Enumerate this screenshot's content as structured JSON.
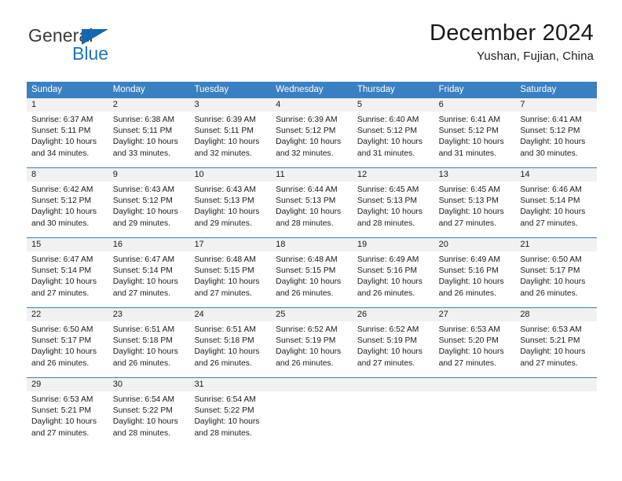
{
  "brand": {
    "name_top": "General",
    "name_bottom": "Blue",
    "triangle_color": "#1565b0",
    "text_color": "#3b3b3b",
    "blue_color": "#1b75bb"
  },
  "header": {
    "title": "December 2024",
    "subtitle": "Yushan, Fujian, China"
  },
  "theme": {
    "header_bar": "#3a7fc1",
    "day_band": "#f1f1f1",
    "text": "#1a1a1a"
  },
  "weekdays": [
    "Sunday",
    "Monday",
    "Tuesday",
    "Wednesday",
    "Thursday",
    "Friday",
    "Saturday"
  ],
  "weeks": [
    [
      {
        "day": "1",
        "sunrise": "Sunrise: 6:37 AM",
        "sunset": "Sunset: 5:11 PM",
        "daylight1": "Daylight: 10 hours",
        "daylight2": "and 34 minutes."
      },
      {
        "day": "2",
        "sunrise": "Sunrise: 6:38 AM",
        "sunset": "Sunset: 5:11 PM",
        "daylight1": "Daylight: 10 hours",
        "daylight2": "and 33 minutes."
      },
      {
        "day": "3",
        "sunrise": "Sunrise: 6:39 AM",
        "sunset": "Sunset: 5:11 PM",
        "daylight1": "Daylight: 10 hours",
        "daylight2": "and 32 minutes."
      },
      {
        "day": "4",
        "sunrise": "Sunrise: 6:39 AM",
        "sunset": "Sunset: 5:12 PM",
        "daylight1": "Daylight: 10 hours",
        "daylight2": "and 32 minutes."
      },
      {
        "day": "5",
        "sunrise": "Sunrise: 6:40 AM",
        "sunset": "Sunset: 5:12 PM",
        "daylight1": "Daylight: 10 hours",
        "daylight2": "and 31 minutes."
      },
      {
        "day": "6",
        "sunrise": "Sunrise: 6:41 AM",
        "sunset": "Sunset: 5:12 PM",
        "daylight1": "Daylight: 10 hours",
        "daylight2": "and 31 minutes."
      },
      {
        "day": "7",
        "sunrise": "Sunrise: 6:41 AM",
        "sunset": "Sunset: 5:12 PM",
        "daylight1": "Daylight: 10 hours",
        "daylight2": "and 30 minutes."
      }
    ],
    [
      {
        "day": "8",
        "sunrise": "Sunrise: 6:42 AM",
        "sunset": "Sunset: 5:12 PM",
        "daylight1": "Daylight: 10 hours",
        "daylight2": "and 30 minutes."
      },
      {
        "day": "9",
        "sunrise": "Sunrise: 6:43 AM",
        "sunset": "Sunset: 5:12 PM",
        "daylight1": "Daylight: 10 hours",
        "daylight2": "and 29 minutes."
      },
      {
        "day": "10",
        "sunrise": "Sunrise: 6:43 AM",
        "sunset": "Sunset: 5:13 PM",
        "daylight1": "Daylight: 10 hours",
        "daylight2": "and 29 minutes."
      },
      {
        "day": "11",
        "sunrise": "Sunrise: 6:44 AM",
        "sunset": "Sunset: 5:13 PM",
        "daylight1": "Daylight: 10 hours",
        "daylight2": "and 28 minutes."
      },
      {
        "day": "12",
        "sunrise": "Sunrise: 6:45 AM",
        "sunset": "Sunset: 5:13 PM",
        "daylight1": "Daylight: 10 hours",
        "daylight2": "and 28 minutes."
      },
      {
        "day": "13",
        "sunrise": "Sunrise: 6:45 AM",
        "sunset": "Sunset: 5:13 PM",
        "daylight1": "Daylight: 10 hours",
        "daylight2": "and 27 minutes."
      },
      {
        "day": "14",
        "sunrise": "Sunrise: 6:46 AM",
        "sunset": "Sunset: 5:14 PM",
        "daylight1": "Daylight: 10 hours",
        "daylight2": "and 27 minutes."
      }
    ],
    [
      {
        "day": "15",
        "sunrise": "Sunrise: 6:47 AM",
        "sunset": "Sunset: 5:14 PM",
        "daylight1": "Daylight: 10 hours",
        "daylight2": "and 27 minutes."
      },
      {
        "day": "16",
        "sunrise": "Sunrise: 6:47 AM",
        "sunset": "Sunset: 5:14 PM",
        "daylight1": "Daylight: 10 hours",
        "daylight2": "and 27 minutes."
      },
      {
        "day": "17",
        "sunrise": "Sunrise: 6:48 AM",
        "sunset": "Sunset: 5:15 PM",
        "daylight1": "Daylight: 10 hours",
        "daylight2": "and 27 minutes."
      },
      {
        "day": "18",
        "sunrise": "Sunrise: 6:48 AM",
        "sunset": "Sunset: 5:15 PM",
        "daylight1": "Daylight: 10 hours",
        "daylight2": "and 26 minutes."
      },
      {
        "day": "19",
        "sunrise": "Sunrise: 6:49 AM",
        "sunset": "Sunset: 5:16 PM",
        "daylight1": "Daylight: 10 hours",
        "daylight2": "and 26 minutes."
      },
      {
        "day": "20",
        "sunrise": "Sunrise: 6:49 AM",
        "sunset": "Sunset: 5:16 PM",
        "daylight1": "Daylight: 10 hours",
        "daylight2": "and 26 minutes."
      },
      {
        "day": "21",
        "sunrise": "Sunrise: 6:50 AM",
        "sunset": "Sunset: 5:17 PM",
        "daylight1": "Daylight: 10 hours",
        "daylight2": "and 26 minutes."
      }
    ],
    [
      {
        "day": "22",
        "sunrise": "Sunrise: 6:50 AM",
        "sunset": "Sunset: 5:17 PM",
        "daylight1": "Daylight: 10 hours",
        "daylight2": "and 26 minutes."
      },
      {
        "day": "23",
        "sunrise": "Sunrise: 6:51 AM",
        "sunset": "Sunset: 5:18 PM",
        "daylight1": "Daylight: 10 hours",
        "daylight2": "and 26 minutes."
      },
      {
        "day": "24",
        "sunrise": "Sunrise: 6:51 AM",
        "sunset": "Sunset: 5:18 PM",
        "daylight1": "Daylight: 10 hours",
        "daylight2": "and 26 minutes."
      },
      {
        "day": "25",
        "sunrise": "Sunrise: 6:52 AM",
        "sunset": "Sunset: 5:19 PM",
        "daylight1": "Daylight: 10 hours",
        "daylight2": "and 26 minutes."
      },
      {
        "day": "26",
        "sunrise": "Sunrise: 6:52 AM",
        "sunset": "Sunset: 5:19 PM",
        "daylight1": "Daylight: 10 hours",
        "daylight2": "and 27 minutes."
      },
      {
        "day": "27",
        "sunrise": "Sunrise: 6:53 AM",
        "sunset": "Sunset: 5:20 PM",
        "daylight1": "Daylight: 10 hours",
        "daylight2": "and 27 minutes."
      },
      {
        "day": "28",
        "sunrise": "Sunrise: 6:53 AM",
        "sunset": "Sunset: 5:21 PM",
        "daylight1": "Daylight: 10 hours",
        "daylight2": "and 27 minutes."
      }
    ],
    [
      {
        "day": "29",
        "sunrise": "Sunrise: 6:53 AM",
        "sunset": "Sunset: 5:21 PM",
        "daylight1": "Daylight: 10 hours",
        "daylight2": "and 27 minutes."
      },
      {
        "day": "30",
        "sunrise": "Sunrise: 6:54 AM",
        "sunset": "Sunset: 5:22 PM",
        "daylight1": "Daylight: 10 hours",
        "daylight2": "and 28 minutes."
      },
      {
        "day": "31",
        "sunrise": "Sunrise: 6:54 AM",
        "sunset": "Sunset: 5:22 PM",
        "daylight1": "Daylight: 10 hours",
        "daylight2": "and 28 minutes."
      },
      {
        "day": "",
        "sunrise": "",
        "sunset": "",
        "daylight1": "",
        "daylight2": ""
      },
      {
        "day": "",
        "sunrise": "",
        "sunset": "",
        "daylight1": "",
        "daylight2": ""
      },
      {
        "day": "",
        "sunrise": "",
        "sunset": "",
        "daylight1": "",
        "daylight2": ""
      },
      {
        "day": "",
        "sunrise": "",
        "sunset": "",
        "daylight1": "",
        "daylight2": ""
      }
    ]
  ]
}
